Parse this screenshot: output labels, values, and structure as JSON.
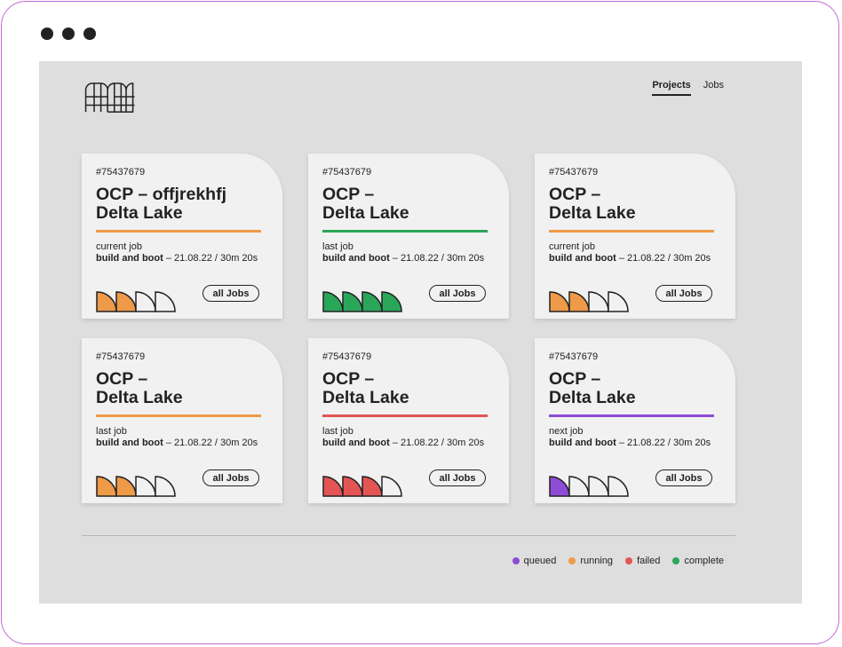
{
  "nav": {
    "items": [
      {
        "label": "Projects",
        "active": true
      },
      {
        "label": "Jobs",
        "active": false
      }
    ]
  },
  "colors": {
    "queued": "#8e4bd6",
    "running": "#ee9a48",
    "failed": "#e35454",
    "complete": "#2aa659",
    "empty": "#f1f1f1"
  },
  "cards": [
    {
      "id": "#75437679",
      "title_line1": "OCP – offjrekhfj",
      "title_line2": "Delta Lake",
      "status": "running",
      "job_label": "current job",
      "job_name": "build and boot",
      "job_meta": " – 21.08.22 / 30m 20s",
      "button": "all Jobs",
      "steps": [
        "running",
        "running",
        "empty",
        "empty"
      ]
    },
    {
      "id": "#75437679",
      "title_line1": "OCP –",
      "title_line2": "Delta Lake",
      "status": "complete",
      "job_label": "last job",
      "job_name": "build and boot",
      "job_meta": " – 21.08.22 / 30m 20s",
      "button": "all Jobs",
      "steps": [
        "complete",
        "complete",
        "complete",
        "complete"
      ]
    },
    {
      "id": "#75437679",
      "title_line1": "OCP –",
      "title_line2": "Delta Lake",
      "status": "running",
      "job_label": "current job",
      "job_name": "build and boot",
      "job_meta": " – 21.08.22 / 30m 20s",
      "button": "all Jobs",
      "steps": [
        "running",
        "running",
        "empty",
        "empty"
      ]
    },
    {
      "id": "#75437679",
      "title_line1": "OCP –",
      "title_line2": "Delta Lake",
      "status": "running",
      "job_label": "last job",
      "job_name": "build and boot",
      "job_meta": " – 21.08.22 / 30m 20s",
      "button": "all Jobs",
      "steps": [
        "running",
        "running",
        "empty",
        "empty"
      ]
    },
    {
      "id": "#75437679",
      "title_line1": "OCP –",
      "title_line2": "Delta Lake",
      "status": "failed",
      "job_label": "last job",
      "job_name": "build and boot",
      "job_meta": " – 21.08.22 / 30m 20s",
      "button": "all Jobs",
      "steps": [
        "failed",
        "failed",
        "failed",
        "empty"
      ]
    },
    {
      "id": "#75437679",
      "title_line1": "OCP –",
      "title_line2": "Delta Lake",
      "status": "queued",
      "job_label": "next job",
      "job_name": "build and boot",
      "job_meta": " – 21.08.22 / 30m 20s",
      "button": "all Jobs",
      "steps": [
        "queued",
        "empty",
        "empty",
        "empty"
      ]
    }
  ],
  "legend": [
    {
      "label": "queued",
      "color": "#8e4bd6"
    },
    {
      "label": "running",
      "color": "#ee9a48"
    },
    {
      "label": "failed",
      "color": "#e35454"
    },
    {
      "label": "complete",
      "color": "#2aa659"
    }
  ]
}
